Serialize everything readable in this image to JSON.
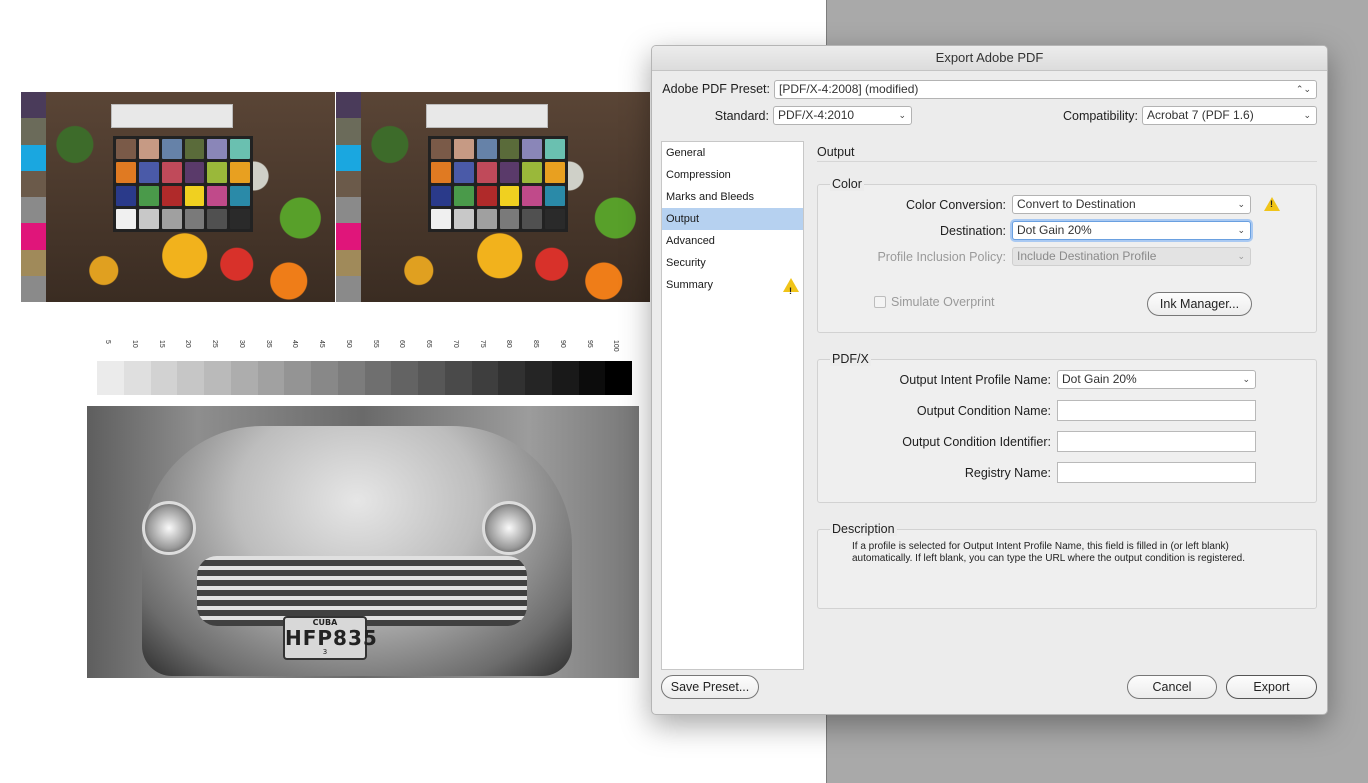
{
  "dialog": {
    "title": "Export Adobe PDF",
    "preset_label": "Adobe PDF Preset:",
    "preset_value": "[PDF/X-4:2008] (modified)",
    "standard_label": "Standard:",
    "standard_value": "PDF/X-4:2010",
    "compat_label": "Compatibility:",
    "compat_value": "Acrobat 7 (PDF 1.6)",
    "sidebar": [
      {
        "label": "General"
      },
      {
        "label": "Compression"
      },
      {
        "label": "Marks and Bleeds"
      },
      {
        "label": "Output"
      },
      {
        "label": "Advanced"
      },
      {
        "label": "Security"
      },
      {
        "label": "Summary"
      }
    ],
    "panel_title": "Output",
    "color": {
      "title": "Color",
      "conversion_label": "Color Conversion:",
      "conversion_value": "Convert to Destination",
      "destination_label": "Destination:",
      "destination_value": "Dot Gain 20%",
      "policy_label": "Profile Inclusion Policy:",
      "policy_value": "Include Destination Profile",
      "simulate_label": "Simulate Overprint",
      "ink_manager_label": "Ink Manager..."
    },
    "pdfx": {
      "title": "PDF/X",
      "intent_label": "Output Intent Profile Name:",
      "intent_value": "Dot Gain 20%",
      "condition_name_label": "Output Condition Name:",
      "condition_id_label": "Output Condition Identifier:",
      "registry_label": "Registry Name:"
    },
    "description": {
      "title": "Description",
      "line1": "If a profile is selected for Output Intent Profile Name, this field is filled in (or left blank)",
      "line2": "automatically. If left blank, you can type the URL where the output condition is registered."
    },
    "buttons": {
      "save_preset": "Save Preset...",
      "cancel": "Cancel",
      "export": "Export"
    }
  },
  "document": {
    "ramp_labels": [
      "5",
      "10",
      "15",
      "20",
      "25",
      "30",
      "35",
      "40",
      "45",
      "50",
      "55",
      "60",
      "65",
      "70",
      "75",
      "80",
      "85",
      "90",
      "95",
      "100"
    ],
    "plate": {
      "top": "CUBA",
      "number": "HFP835",
      "bottom": "3"
    }
  },
  "colors": {
    "selection": "#b6d1f0",
    "warning": "#f0c419",
    "swatches": [
      "#4a3b5a",
      "#6b6b5a",
      "#1aa7e0",
      "#6b5a4a",
      "#8a8a8a",
      "#e0157a",
      "#a08a5a",
      "#8a8a8a"
    ],
    "checker": [
      "#7a5a48",
      "#c69a84",
      "#6682a8",
      "#5a6b3a",
      "#8a86b8",
      "#6ac0b0",
      "#e07a22",
      "#4a5aa8",
      "#c04a5a",
      "#5a3a6a",
      "#9ab83a",
      "#e8a020",
      "#2a3a8a",
      "#4a9a4a",
      "#b02a2a",
      "#f0d020",
      "#c04a8a",
      "#2a8aa8",
      "#f0f0f0",
      "#c8c8c8",
      "#a0a0a0",
      "#7a7a7a",
      "#505050",
      "#2a2a2a"
    ]
  }
}
